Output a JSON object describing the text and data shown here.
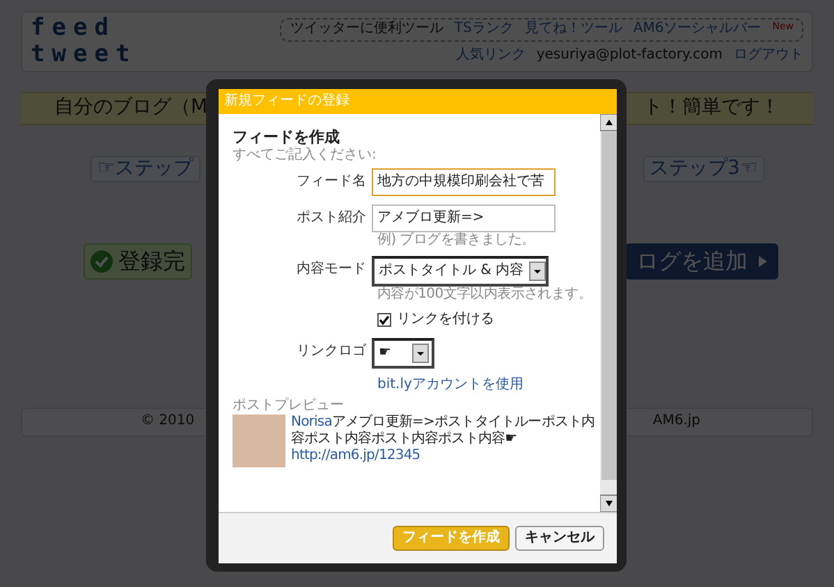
{
  "page": {
    "logo": {
      "lines": [
        "feed",
        "tweet"
      ]
    },
    "nav_links": [
      {
        "kind": "text",
        "label": "ツイッターに便利ツール"
      },
      {
        "kind": "link",
        "label": "TSランク"
      },
      {
        "kind": "link",
        "label": "見てね！ツール"
      },
      {
        "kind": "link",
        "label": "AM6ソーシャルバー",
        "badge": "New"
      }
    ],
    "account_links": [
      {
        "kind": "link",
        "label": "人気リンク"
      },
      {
        "kind": "text",
        "label": "yesuriya@plot-factory.com"
      },
      {
        "kind": "link",
        "label": "ログアウト"
      }
    ],
    "banner": [
      "自分のブログ（M",
      "ト！簡単です！"
    ],
    "steps": [
      {
        "label": "☞ステップ"
      },
      {
        "label": "ステップ3☜"
      }
    ],
    "actions": [
      {
        "kind": "done",
        "label": "登録完"
      },
      {
        "kind": "add",
        "label": "ログを追加"
      }
    ],
    "footer": [
      "© 2010",
      "AM6.jp"
    ]
  },
  "dialog": {
    "title": "新規フィードの登録",
    "heading": "フィードを作成",
    "note": "すべてご記入ください:",
    "fields": [
      {
        "kind": "text",
        "label": "フィード名",
        "value": "地方の中規模印刷会社で苦",
        "focused": true
      },
      {
        "kind": "text",
        "label": "ポスト紹介",
        "value": "アメブロ更新=>",
        "hint": "例) ブログを書きました。",
        "focused": false
      },
      {
        "kind": "select",
        "label": "内容モード",
        "value": "ポストタイトル & 内容",
        "hint": "内容が100文字以内表示されます。"
      },
      {
        "kind": "checkbox",
        "label": "リンクを付ける",
        "checked": true
      },
      {
        "kind": "select",
        "label": "リンクロゴ",
        "value": "☛"
      },
      {
        "kind": "link",
        "label": "bit.lyアカウントを使用"
      }
    ],
    "preview": {
      "label": "ポストプレビュー",
      "user": "Norisa",
      "text": "アメブロ更新=>ポストタイトルーポスト内容ポスト内容ポスト内容ポスト内容",
      "mark": "☛",
      "url": "http://am6.jp/12345"
    },
    "buttons": [
      {
        "kind": "primary",
        "label": "フィードを作成"
      },
      {
        "kind": "secondary",
        "label": "キャンセル"
      }
    ]
  }
}
